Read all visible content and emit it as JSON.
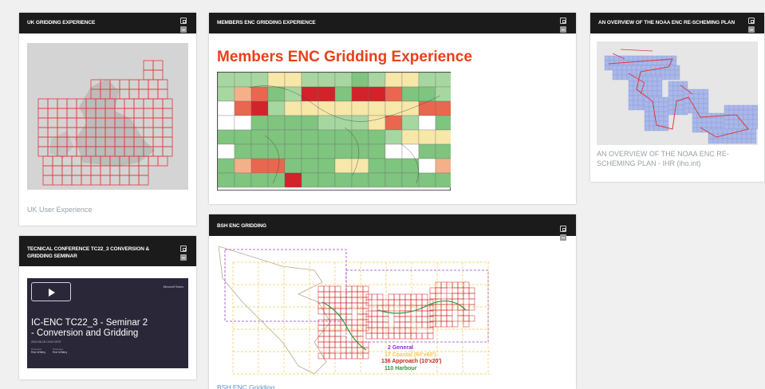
{
  "cards": {
    "uk": {
      "title": "UK GRIDDING EXPERIENCE",
      "caption": "UK User Experience"
    },
    "members": {
      "title": "MEMBERS ENC GRIDDING EXPERIENCE",
      "chart_title": "Members ENC Gridding Experience"
    },
    "noaa": {
      "title": "AN OVERVIEW OF THE NOAA ENC RE-SCHEMING PLAN",
      "caption": "AN OVERVIEW OF THE NOAA ENC RE-SCHEMING PLAN - IHR (iho.int)"
    },
    "tc22": {
      "title": "TECNICAL CONFERENCE TC22_3 CONVERSION & GRIDDING SEMINAR",
      "video": {
        "brand": "Microsoft Teams",
        "title": "IC-ENC TC22_3 - Seminar 2 - Conversion and Gridding",
        "date": "2022-06-16 13:00 CEST",
        "presenter_label_1": "Presenter",
        "presenter_1": "Rob Whitey",
        "presenter_label_2": "Presenter",
        "presenter_2": "Rob Whitey"
      }
    },
    "bsh": {
      "title": "BSH ENC GRIDDING",
      "caption": "BSH ENC Gridding",
      "legend": [
        {
          "text": "2 General",
          "color": "#8a2be2"
        },
        {
          "text": "17 Coastal (60'x60')",
          "color": "#f2c94c"
        },
        {
          "text": "136 Approach (10'x20')",
          "color": "#cc2222"
        },
        {
          "text": "110 Harbour",
          "color": "#2e9a3c"
        }
      ]
    }
  },
  "icons": {
    "expand": "expand-icon",
    "minimize": "minimize-icon",
    "play": "play-icon"
  },
  "colors": {
    "header": "#1b1b1b",
    "grid_red": "#e03a3a",
    "chart_title": "#e8401c",
    "link": "#5b8fc7"
  }
}
